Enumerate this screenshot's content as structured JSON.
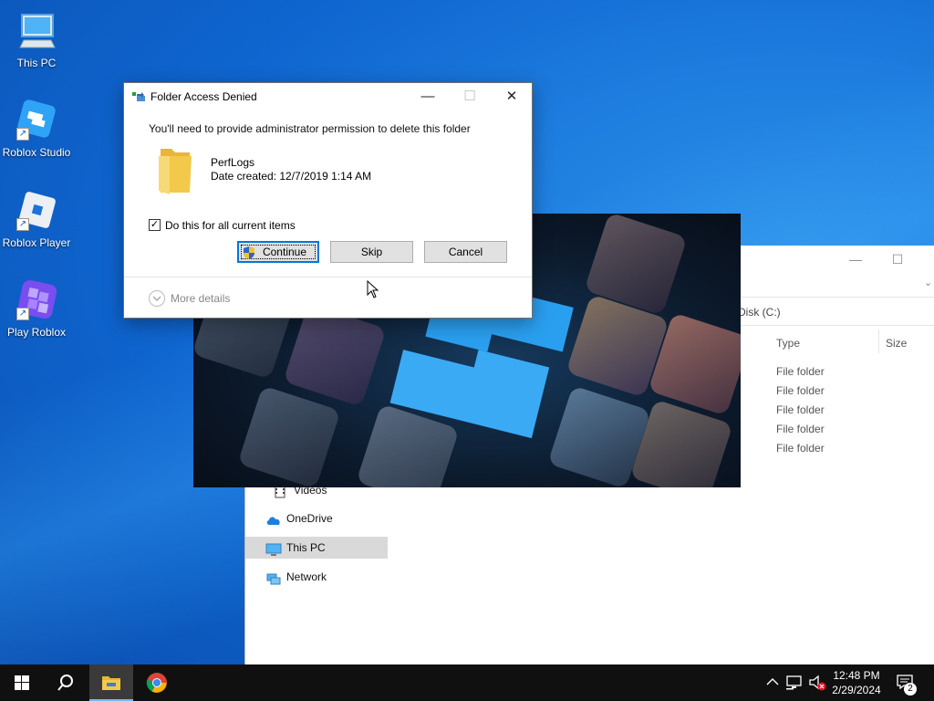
{
  "desktop": {
    "icons": [
      {
        "label": "This PC"
      },
      {
        "label": "Roblox Studio"
      },
      {
        "label": "Roblox Player"
      },
      {
        "label": "Play Roblox"
      }
    ]
  },
  "explorer": {
    "address": "Disk (C:)",
    "columns": {
      "type": "Type",
      "size": "Size"
    },
    "rows": [
      "File folder",
      "File folder",
      "File folder",
      "File folder",
      "File folder"
    ],
    "nav": {
      "videos": "Videos",
      "onedrive": "OneDrive",
      "this_pc": "This PC",
      "network": "Network"
    }
  },
  "dialog": {
    "title": "Folder Access Denied",
    "message": "You'll need to provide administrator permission to delete this folder",
    "folder_name": "PerfLogs",
    "date_created": "Date created: 12/7/2019 1:14 AM",
    "checkbox_label": "Do this for all current items",
    "checkbox_checked": true,
    "continue_label": "Continue",
    "skip_label": "Skip",
    "cancel_label": "Cancel",
    "more_details_label": "More details"
  },
  "taskbar": {
    "time": "12:48 PM",
    "date": "2/29/2024",
    "notification_count": "2"
  },
  "colors": {
    "accent": "#0078d7",
    "taskbar": "#101010",
    "folder": "#f3c94b"
  }
}
